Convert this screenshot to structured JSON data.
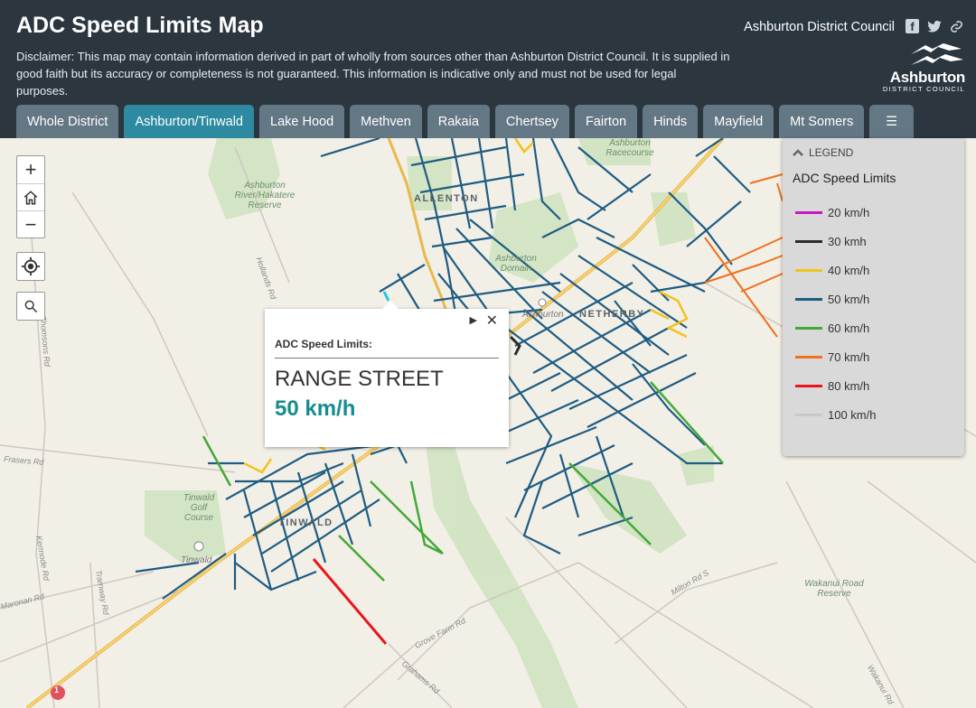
{
  "header": {
    "title": "ADC Speed Limits Map",
    "disclaimer": "Disclaimer: This map may contain information derived in part of wholly from sources other than Ashburton District Council. It is supplied in good faith but its accuracy or completeness is not guaranteed. This information is indicative only and must not be used for legal purposes.",
    "council_name": "Ashburton District Council",
    "logo_text": "Ashburton",
    "logo_subtext": "DISTRICT COUNCIL",
    "facebook_glyph": "f",
    "twitter_glyph": "",
    "link_glyph": ""
  },
  "tabs": [
    {
      "label": "Whole District",
      "active": false
    },
    {
      "label": "Ashburton/Tinwald",
      "active": true
    },
    {
      "label": "Lake Hood",
      "active": false
    },
    {
      "label": "Methven",
      "active": false
    },
    {
      "label": "Rakaia",
      "active": false
    },
    {
      "label": "Chertsey",
      "active": false
    },
    {
      "label": "Fairton",
      "active": false
    },
    {
      "label": "Hinds",
      "active": false
    },
    {
      "label": "Mayfield",
      "active": false
    },
    {
      "label": "Mt Somers",
      "active": false
    }
  ],
  "tab_menu_glyph": "☰",
  "map_controls": {
    "zoom_in": "+",
    "zoom_out": "−",
    "home_icon": "home-icon",
    "locate_icon": "locate-icon",
    "search_icon": "search-icon"
  },
  "map_labels": {
    "allenton": "ALLENTON",
    "netherby": "NETHERBY",
    "tinwald": "TINWALD",
    "hakatere": "Ashburton River/Hakatere Reserve",
    "domain": "Ashburton Domain",
    "racecourse": "Ashburton Racecourse",
    "golf": "Tinwald Golf Course",
    "wakanui": "Wakanui Road Reserve",
    "tinwald_poi": "Tinwald",
    "ashburton_poi": "Ashburton",
    "roads": {
      "hollands": "Hollands Rd",
      "frasers": "Frasers Rd",
      "kermode": "Kermode Rd",
      "thomsons": "Thomsons Rd",
      "tramway": "Tramway Rd",
      "milton": "Milton Rd S",
      "grove": "Grove Farm Rd",
      "grahams": "Grahams Rd",
      "wakanui_rd": "Wakanui Rd",
      "carters": "Carters Rd",
      "maronan": "Maronan Rd",
      "highway": "Archibald St",
      "sh_number": "1"
    }
  },
  "popup": {
    "layer": "ADC Speed Limits:",
    "street": "RANGE STREET",
    "speed": "50 km/h",
    "close_glyph": "✕",
    "next_glyph": "▶"
  },
  "legend": {
    "header": "LEGEND",
    "title": "ADC Speed Limits",
    "items": [
      {
        "label": "20 km/h",
        "color": "#c41bbf"
      },
      {
        "label": "30 kmh",
        "color": "#2b2b2b"
      },
      {
        "label": "40 km/h",
        "color": "#f2c31b"
      },
      {
        "label": "50 km/h",
        "color": "#1e5c82"
      },
      {
        "label": "60 km/h",
        "color": "#43a83a"
      },
      {
        "label": "70 km/h",
        "color": "#f0701e"
      },
      {
        "label": "80 km/h",
        "color": "#e8161c"
      },
      {
        "label": "100 km/h",
        "color": "#c9c9c9"
      }
    ]
  },
  "colors": {
    "header_bg": "#2b363f",
    "tab_bg": "#647785",
    "tab_active_bg": "#2d8aa0",
    "speed_text": "#168d8f",
    "road_50": "#1e5c82"
  }
}
